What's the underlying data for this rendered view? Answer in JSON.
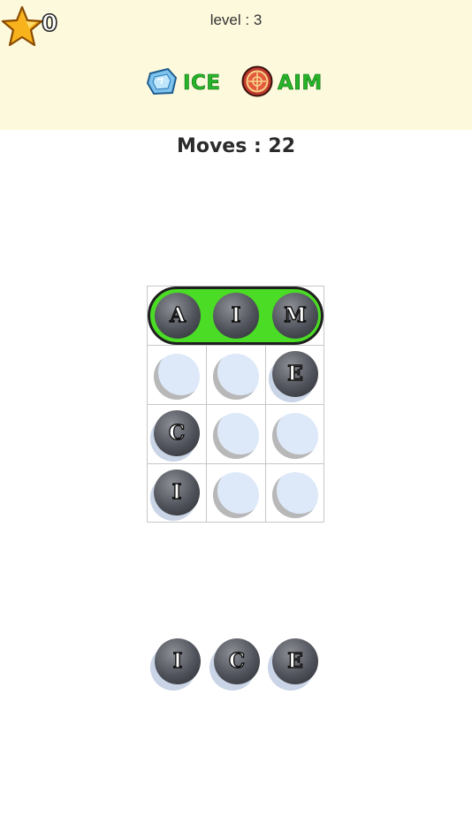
{
  "header": {
    "stars": "0",
    "level": "level : 3",
    "goals": [
      {
        "word": "ICE",
        "icon": "ice-cube-icon"
      },
      {
        "word": "AIM",
        "icon": "target-icon"
      }
    ]
  },
  "moves": "Moves : 22",
  "board": {
    "solved_word": {
      "letters": [
        "A",
        "I",
        "M"
      ]
    },
    "rows": [
      [
        "",
        "",
        "E"
      ],
      [
        "C",
        "",
        ""
      ],
      [
        "I",
        "",
        ""
      ]
    ]
  },
  "tray": {
    "letters": [
      "I",
      "C",
      "E"
    ]
  },
  "colors": {
    "header_bg": "#fdf9dc",
    "goal_text": "#27b42a",
    "solved_highlight": "#4bdc26",
    "empty_slot": "#dde9f9"
  }
}
